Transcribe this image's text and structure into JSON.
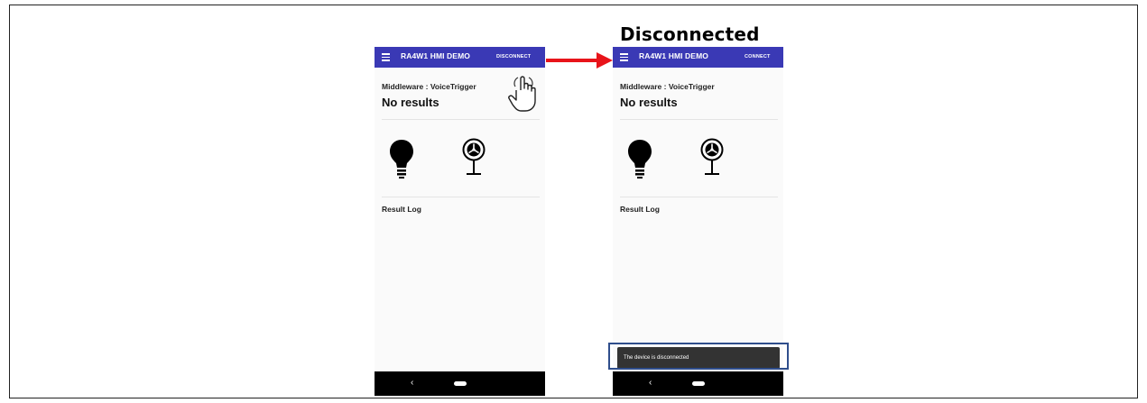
{
  "status_heading": "Disconnected",
  "phone_before": {
    "app_title": "RA4W1 HMI DEMO",
    "action_button": "DISCONNECT",
    "middleware_label": "Middleware : VoiceTrigger",
    "result_text": "No results",
    "result_log_label": "Result Log",
    "nav_back_glyph": "‹"
  },
  "phone_after": {
    "app_title": "RA4W1 HMI DEMO",
    "action_button": "CONNECT",
    "middleware_label": "Middleware : VoiceTrigger",
    "result_text": "No results",
    "result_log_label": "Result Log",
    "snackbar_text": "The device is disconnected",
    "nav_back_glyph": "‹"
  },
  "colors": {
    "appbar": "#3a39b5",
    "arrow": "#e8141a",
    "highlight_box": "#2f4e8c"
  },
  "icons": [
    "menu-icon",
    "lightbulb-icon",
    "fan-icon",
    "tap-hand-icon",
    "arrow-right-icon",
    "back-icon",
    "home-icon"
  ]
}
